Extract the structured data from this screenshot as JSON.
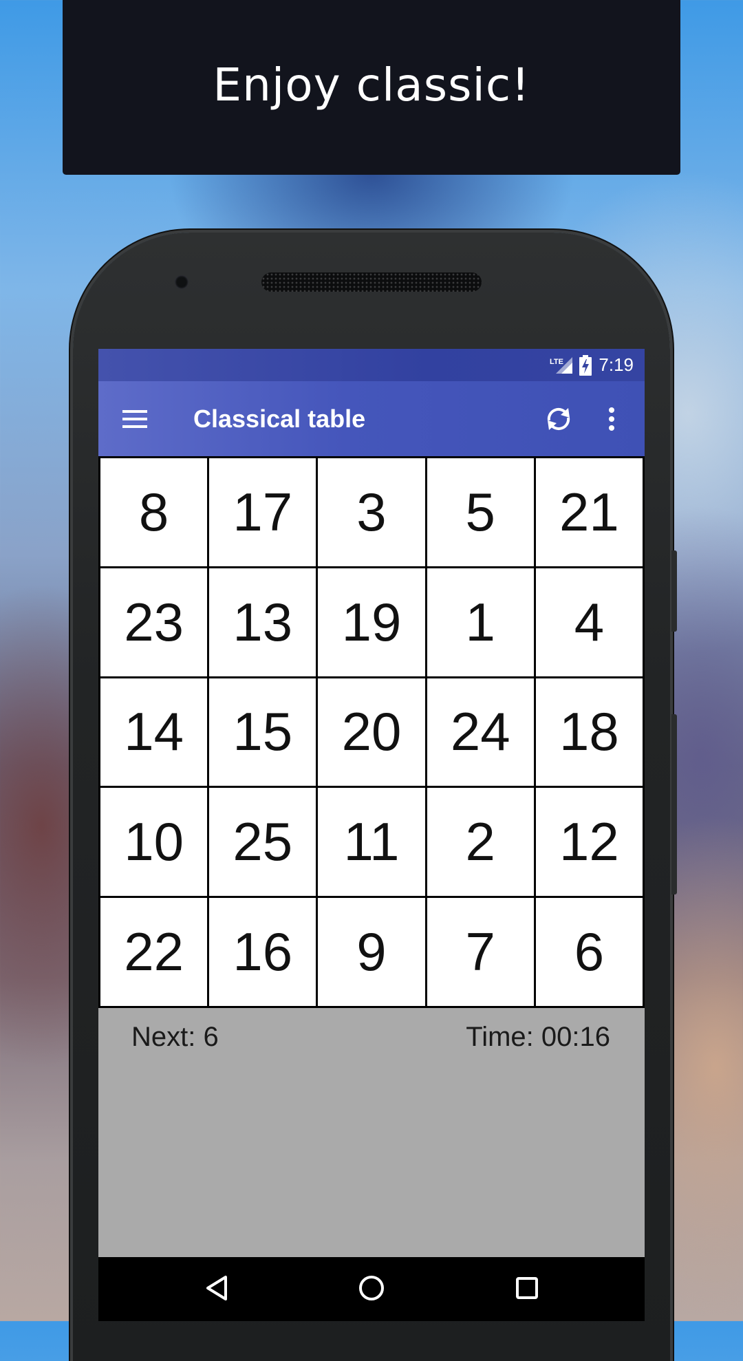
{
  "banner": {
    "title": "Enjoy classic!"
  },
  "status_bar": {
    "network": "LTE",
    "time": "7:19",
    "icons": [
      "lte-signal-icon",
      "battery-charging-icon"
    ]
  },
  "app_bar": {
    "title": "Classical table",
    "icons": [
      "hamburger-menu-icon",
      "refresh-icon",
      "overflow-menu-icon"
    ]
  },
  "grid": {
    "rows": [
      [
        "8",
        "17",
        "3",
        "5",
        "21"
      ],
      [
        "23",
        "13",
        "19",
        "1",
        "4"
      ],
      [
        "14",
        "15",
        "20",
        "24",
        "18"
      ],
      [
        "10",
        "25",
        "11",
        "2",
        "12"
      ],
      [
        "22",
        "16",
        "9",
        "7",
        "6"
      ]
    ]
  },
  "info": {
    "next": "Next: 6",
    "time": "Time: 00:16"
  },
  "nav_bar": {
    "icons": [
      "back-icon",
      "home-icon",
      "recents-icon"
    ]
  },
  "colors": {
    "banner_bg": "#12141d",
    "app_bar": "#3f51b5",
    "status_bar": "#3241a0",
    "screen_bg": "#aaaaaa"
  }
}
